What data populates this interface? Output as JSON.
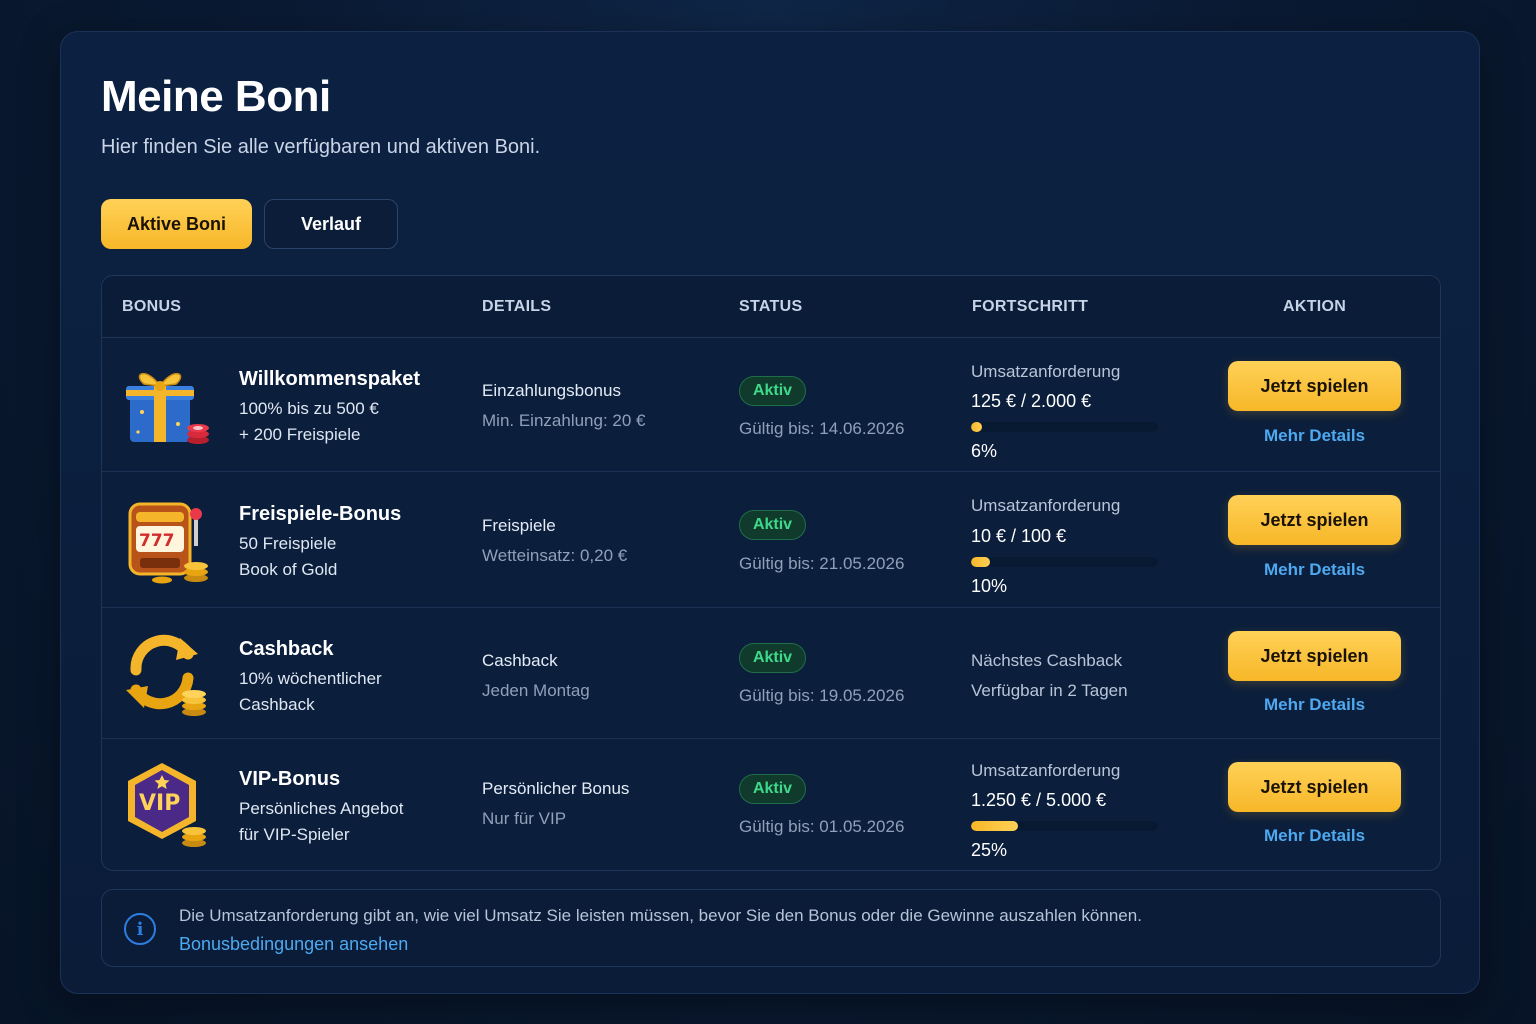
{
  "page": {
    "title": "Meine Boni",
    "subtitle": "Hier finden Sie alle verfügbaren und aktiven Boni."
  },
  "tabs": [
    {
      "label": "Aktive Boni",
      "active": true
    },
    {
      "label": "Verlauf",
      "active": false
    }
  ],
  "table": {
    "headers": [
      "BONUS",
      "DETAILS",
      "STATUS",
      "FORTSCHRITT",
      "AKTION"
    ],
    "rows": [
      {
        "icon": "gift-box-icon",
        "name": "Willkommenspaket",
        "lines": [
          "100% bis zu 500 €",
          "+ 200 Freispiele"
        ],
        "detail_title": "Einzahlungsbonus",
        "detail_sub": "Min. Einzahlung: 20 €",
        "status": "Aktiv",
        "valid": "Gültig bis: 14.06.2026",
        "progress_label": "Umsatzanforderung",
        "progress_value": "125 € / 2.000 €",
        "progress_fraction": 0.06,
        "progress_pct": "6%",
        "action": "Jetzt spielen",
        "details_link": "Mehr Details"
      },
      {
        "icon": "slot-machine-icon",
        "name": "Freispiele-Bonus",
        "lines": [
          "50 Freispiele",
          "Book of Gold"
        ],
        "detail_title": "Freispiele",
        "detail_sub": "Wetteinsatz: 0,20 €",
        "status": "Aktiv",
        "valid": "Gültig bis: 21.05.2026",
        "progress_label": "Umsatzanforderung",
        "progress_value": "10 € / 100 €",
        "progress_fraction": 0.1,
        "progress_pct": "10%",
        "action": "Jetzt spielen",
        "details_link": "Mehr Details"
      },
      {
        "icon": "cashback-arrows-icon",
        "name": "Cashback",
        "lines": [
          "10% wöchentlicher",
          "Cashback"
        ],
        "detail_title": "Cashback",
        "detail_sub": "Jeden Montag",
        "status": "Aktiv",
        "valid": "Gültig bis: 19.05.2026",
        "progress_label": "Nächstes Cashback",
        "progress_value": "Verfügbar in 2 Tagen",
        "action": "Jetzt spielen",
        "details_link": "Mehr Details"
      },
      {
        "icon": "vip-badge-icon",
        "name": "VIP-Bonus",
        "lines": [
          "Persönliches Angebot",
          "für VIP-Spieler"
        ],
        "detail_title": "Persönlicher Bonus",
        "detail_sub": "Nur für VIP",
        "status": "Aktiv",
        "valid": "Gültig bis: 01.05.2026",
        "progress_label": "Umsatzanforderung",
        "progress_value": "1.250 € / 5.000 €",
        "progress_fraction": 0.25,
        "progress_pct": "25%",
        "action": "Jetzt spielen",
        "details_link": "Mehr Details"
      }
    ]
  },
  "info": {
    "icon": "info-icon",
    "text": "Die Umsatzanforderung gibt an, wie viel Umsatz Sie leisten müssen, bevor Sie den Bonus oder die Gewinne auszahlen können.",
    "link": "Bonusbedingungen ansehen"
  },
  "colors": {
    "accent": "#f7b728",
    "link": "#4ea9f0",
    "status_active": "#3fd98a",
    "background": "#0a1c37"
  }
}
